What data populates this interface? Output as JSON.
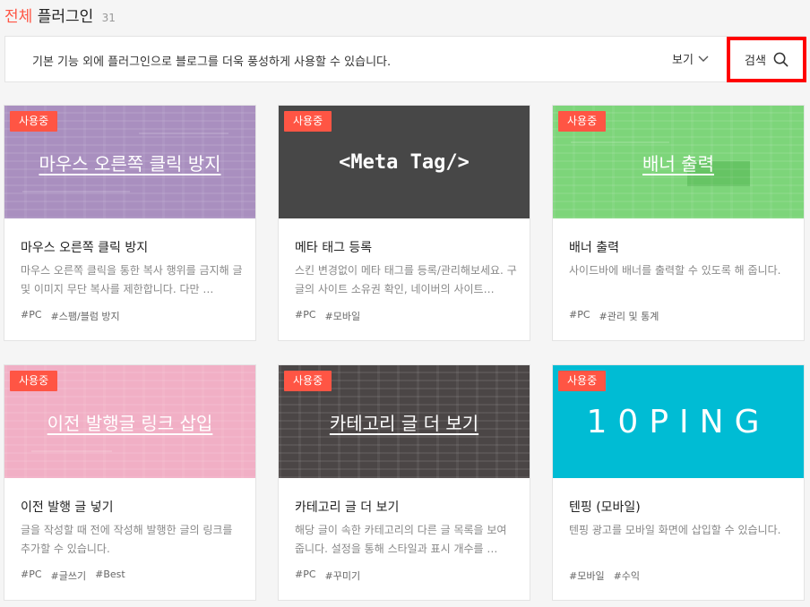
{
  "header": {
    "title_accent": "전체",
    "title_rest": "플러그인",
    "count": "31"
  },
  "info_bar": {
    "text": "기본 기능 외에 플러그인으로 블로그를 더욱 풍성하게 사용할 수 있습니다.",
    "view_label": "보기",
    "search_label": "검색"
  },
  "colors": {
    "accent": "#ff5544",
    "highlight": "#ff0000"
  },
  "cards": [
    {
      "badge": "사용중",
      "thumb_text": "마우스 오른쪽 클릭 방지",
      "thumb_color": "#a98fbf",
      "title": "마우스 오른쪽 클릭 방지",
      "desc": "마우스 오른쪽 클릭을 통한 복사 행위를 금지해 글 및 이미지 무단 복사를 제한합니다. 다만 …",
      "tags": [
        "#PC",
        "#스팸/블럼 방지"
      ]
    },
    {
      "badge": "사용중",
      "thumb_text": "<Meta Tag/>",
      "thumb_color": "#474747",
      "title": "메타 태그 등록",
      "desc": "스킨 변경없이 메타 태그를 등록/관리해보세요. 구글의 사이트 소유권 확인, 네이버의 사이트…",
      "tags": [
        "#PC",
        "#모바일"
      ]
    },
    {
      "badge": "사용중",
      "thumb_text": "배너 출력",
      "thumb_color": "#7dd57a",
      "title": "배너 출력",
      "desc": "사이드바에 배너를 출력할 수 있도록 해 줍니다.",
      "tags": [
        "#PC",
        "#관리 및 통계"
      ]
    },
    {
      "badge": "사용중",
      "thumb_text": "이전 발행글 링크 삽입",
      "thumb_color": "#f1afc5",
      "title": "이전 발행 글 넣기",
      "desc": "글을 작성할 때 전에 작성해 발행한 글의 링크를 추가할 수 있습니다.",
      "tags": [
        "#PC",
        "#글쓰기",
        "#Best"
      ]
    },
    {
      "badge": "사용중",
      "thumb_text": "카테고리 글 더 보기",
      "thumb_color": "#4b4646",
      "title": "카테고리 글 더 보기",
      "desc": "해당 글이 속한 카테고리의 다른 글 목록을 보여 줍니다. 설정을 통해 스타일과 표시 개수를 …",
      "tags": [
        "#PC",
        "#꾸미기"
      ]
    },
    {
      "badge": "사용중",
      "thumb_text": "10PING",
      "thumb_color": "#00bcd4",
      "title": "텐핑 (모바일)",
      "desc": "텐핑 광고를 모바일 화면에 삽입할 수 있습니다.",
      "tags": [
        "#모바일",
        "#수익"
      ]
    }
  ]
}
